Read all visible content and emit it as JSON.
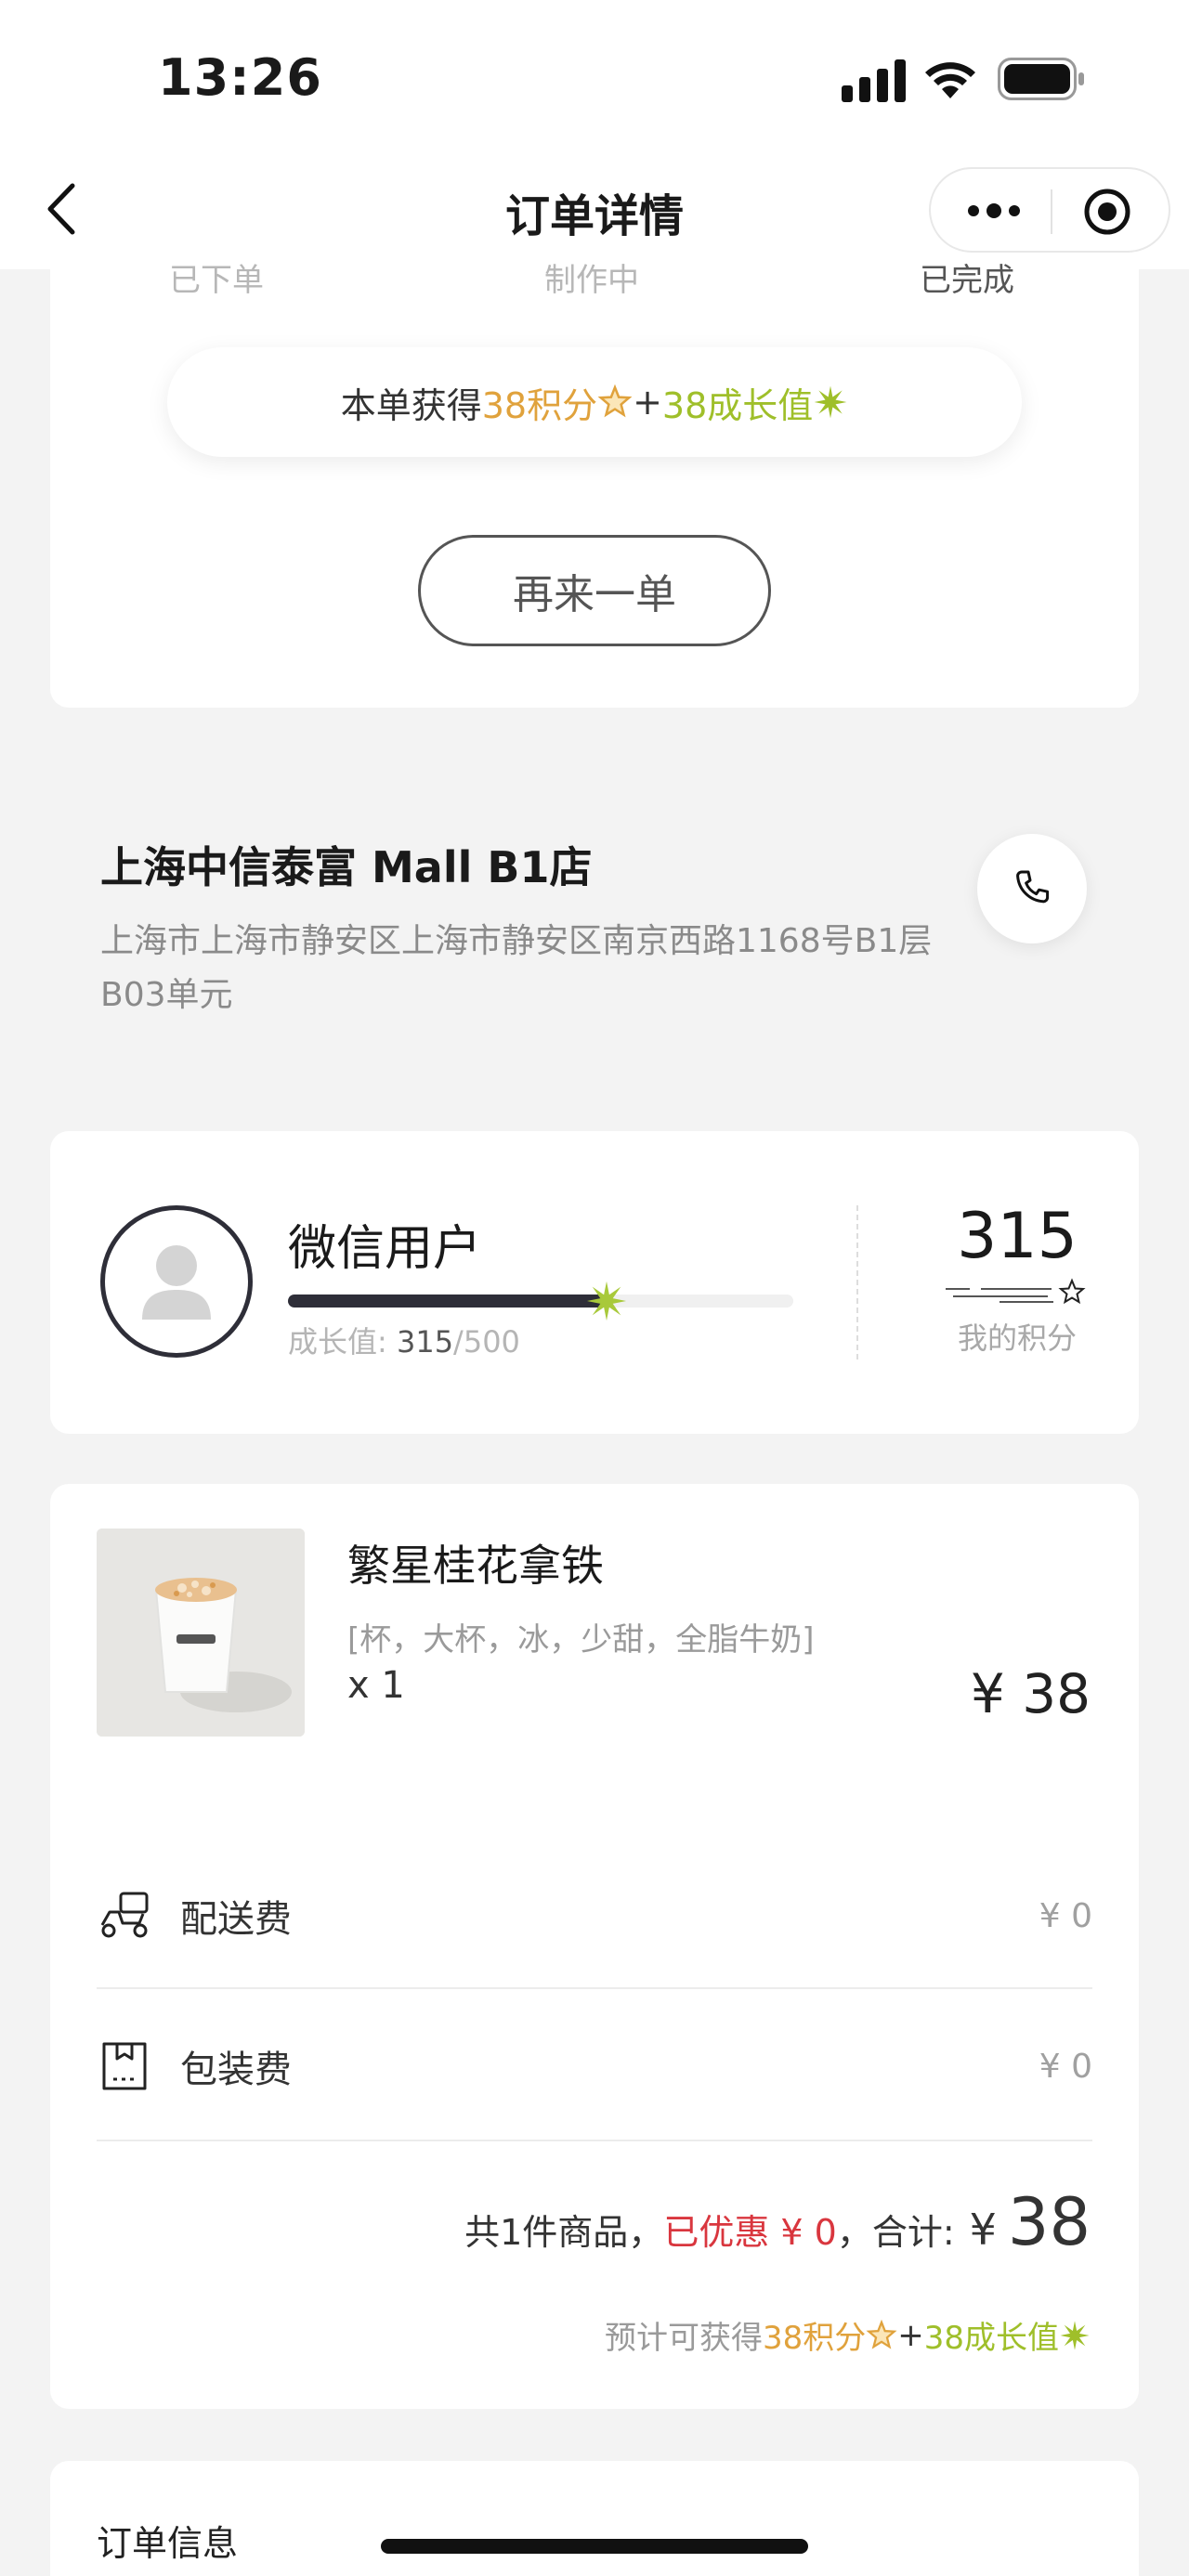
{
  "status_bar": {
    "time": "13:26",
    "icons": [
      "signal-icon",
      "wifi-icon",
      "battery-icon"
    ]
  },
  "nav": {
    "title": "订单详情",
    "back_icon": "chevron-left-icon",
    "more_icon": "more-dots-icon",
    "close_icon": "target-icon"
  },
  "order_status": {
    "steps": [
      "已下单",
      "制作中",
      "已完成"
    ],
    "reward": {
      "prefix": "本单获得 ",
      "points": "38积分",
      "plus": " + ",
      "growth": "38成长值"
    },
    "reorder_label": "再来一单"
  },
  "store": {
    "name": "上海中信泰富 Mall B1店",
    "address": "上海市上海市静安区上海市静安区南京西路1168号B1层B03单元",
    "phone_icon": "phone-icon"
  },
  "user": {
    "name": "微信用户",
    "growth_label": "成长值: ",
    "growth_current": "315",
    "growth_max": "/500",
    "growth_fraction": 0.63,
    "points": "315",
    "points_label": "我的积分"
  },
  "order": {
    "product": {
      "name": "繁星桂花拿铁",
      "spec": "[杯，大杯，冰，少甜，全脂牛奶]",
      "qty": "x 1",
      "price": "¥ 38"
    },
    "fees": [
      {
        "label": "配送费",
        "value": "¥ 0",
        "icon": "scooter-icon"
      },
      {
        "label": "包装费",
        "value": "¥ 0",
        "icon": "package-icon"
      }
    ],
    "summary": {
      "count_text": "共1件商品，",
      "discount_text": "已优惠 ¥ 0",
      "total_label": "，合计: ",
      "yen": "¥",
      "total": "38"
    },
    "estimate": {
      "prefix": "预计可获得 ",
      "points": "38积分",
      "plus": " + ",
      "growth": "38成长值"
    }
  },
  "info": {
    "title": "订单信息"
  },
  "colors": {
    "orange": "#e0a23c",
    "green": "#9fbf2a",
    "red": "#d9363e",
    "dark": "#2e2e38"
  }
}
